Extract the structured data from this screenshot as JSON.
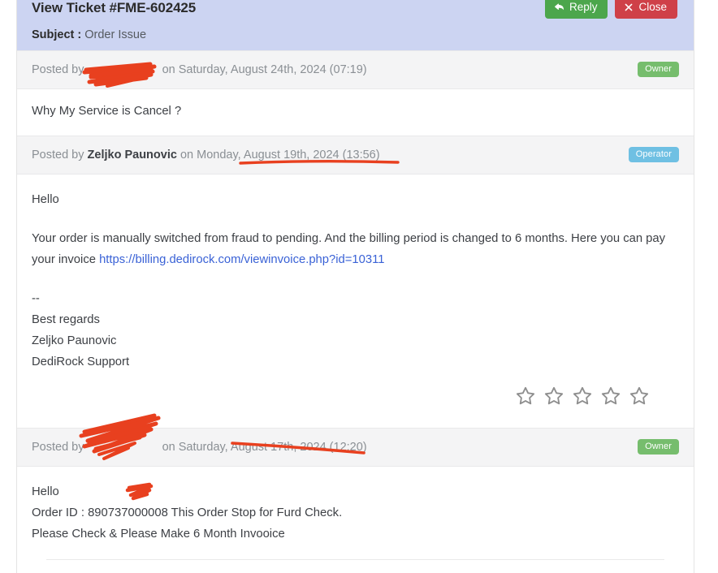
{
  "header": {
    "title": "View Ticket #FME-602425",
    "subject_label": "Subject :",
    "subject_value": "Order Issue",
    "reply_label": "Reply",
    "close_label": "Close",
    "background_color": "#ccd4f2",
    "reply_color": "#4ca64c",
    "close_color": "#cf4048"
  },
  "posts": [
    {
      "meta_prefix": "Posted by",
      "author": "",
      "author_redacted": true,
      "meta_suffix": "on Saturday, August 24th, 2024 (07:19)",
      "badge": "Owner",
      "badge_color": "#76bd6d",
      "lines": [
        {
          "text": "Why My Service is Cancel ?",
          "spaced": false
        }
      ],
      "has_rating": false
    },
    {
      "meta_prefix": "Posted by",
      "author": "Zeljko Paunovic",
      "author_redacted": false,
      "meta_suffix": "on Monday, August 19th, 2024 (13:56)",
      "badge": "Operator",
      "badge_color": "#6fc0e3",
      "lines": [
        {
          "text": "Hello",
          "spaced": false
        },
        {
          "text": "Your order is manually switched from fraud to pending. And the billing period is changed to 6 months. Here you can pay your invoice ",
          "spaced": true,
          "link": "https://billing.dedirock.com/viewinvoice.php?id=10311"
        },
        {
          "text": "--",
          "spaced": true
        },
        {
          "text": "Best regards",
          "spaced": false
        },
        {
          "text": "Zeljko Paunovic",
          "spaced": false
        },
        {
          "text": "DediRock Support",
          "spaced": false
        }
      ],
      "has_rating": true,
      "rating_stars": 5,
      "rating_filled": 0,
      "rating_color": "#8e8e8e"
    },
    {
      "meta_prefix": "Posted by",
      "author": "",
      "author_redacted": true,
      "meta_suffix": "on Saturday, August 17th, 2024 (12:20)",
      "badge": "Owner",
      "badge_color": "#76bd6d",
      "lines": [
        {
          "text": "Hello",
          "spaced": false
        },
        {
          "text": "Order ID : 890737000008 This Order Stop for Furd Check.",
          "spaced": false
        },
        {
          "text": "Please Check & Please Make 6 Month Invooice",
          "spaced": false
        }
      ],
      "has_rating": false
    }
  ],
  "annotations": {
    "color": "#e8401f",
    "description": "hand-drawn red redaction scribbles over usernames and order id, plus red underlines beneath post dates"
  }
}
